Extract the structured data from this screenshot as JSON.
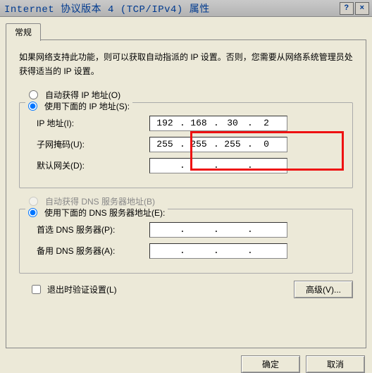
{
  "title": "Internet 协议版本 4 (TCP/IPv4) 属性",
  "titlebar": {
    "help": "?",
    "close": "×"
  },
  "tab": {
    "general": "常规"
  },
  "desc": "如果网络支持此功能，则可以获取自动指派的 IP 设置。否则，您需要从网络系统管理员处获得适当的 IP 设置。",
  "ip": {
    "auto": "自动获得 IP 地址(O)",
    "manual": "使用下面的 IP 地址(S):",
    "address_label": "IP 地址(I):",
    "mask_label": "子网掩码(U):",
    "gateway_label": "默认网关(D):",
    "address": [
      "192",
      "168",
      "30",
      "2"
    ],
    "mask": [
      "255",
      "255",
      "255",
      "0"
    ],
    "gateway": [
      "",
      "",
      "",
      ""
    ]
  },
  "dns": {
    "auto": "自动获得 DNS 服务器地址(B)",
    "manual": "使用下面的 DNS 服务器地址(E):",
    "pref_label": "首选 DNS 服务器(P):",
    "alt_label": "备用 DNS 服务器(A):",
    "pref": [
      "",
      "",
      "",
      ""
    ],
    "alt": [
      "",
      "",
      "",
      ""
    ]
  },
  "validate": "退出时验证设置(L)",
  "buttons": {
    "advanced": "高级(V)...",
    "ok": "确定",
    "cancel": "取消"
  }
}
